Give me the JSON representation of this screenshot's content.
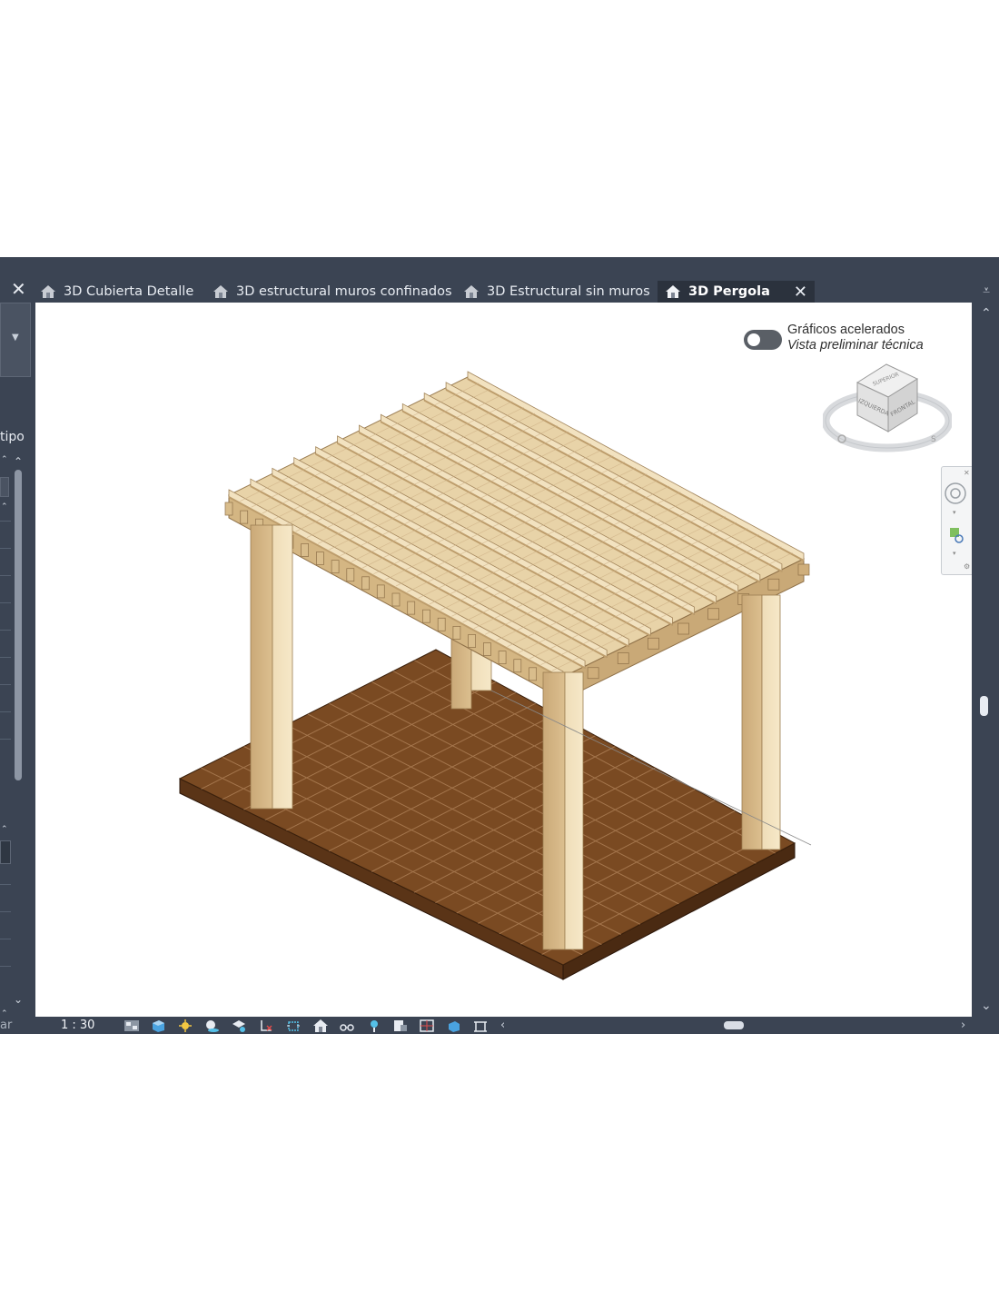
{
  "tabs": [
    {
      "label": "3D Cubierta Detalle",
      "icon": "house-3d-icon"
    },
    {
      "label": "3D estructural muros confinados",
      "icon": "house-3d-icon"
    },
    {
      "label": "3D Estructural sin muros",
      "icon": "house-3d-icon"
    },
    {
      "label": "3D Pergola",
      "icon": "house-3d-icon",
      "active": true
    }
  ],
  "left_panel": {
    "type_label_fragment": "tipo",
    "bottom_fragment": "ar"
  },
  "viewport": {
    "graphics_label": "Gráficos acelerados",
    "preview_label": "Vista preliminar técnica",
    "graphics_toggle_on": false,
    "viewcube": {
      "top": "SUPERIOR",
      "left": "IZQUIERDA",
      "front": "FRONTAL"
    },
    "colors": {
      "wood": "#e6cfa2",
      "floor": "#7a4a22",
      "background": "#ffffff"
    }
  },
  "status_bar": {
    "scale": "1 : 30"
  },
  "colors": {
    "chrome": "#3b4453",
    "active_tab": "#2b323d",
    "text": "#e8ecf2"
  }
}
